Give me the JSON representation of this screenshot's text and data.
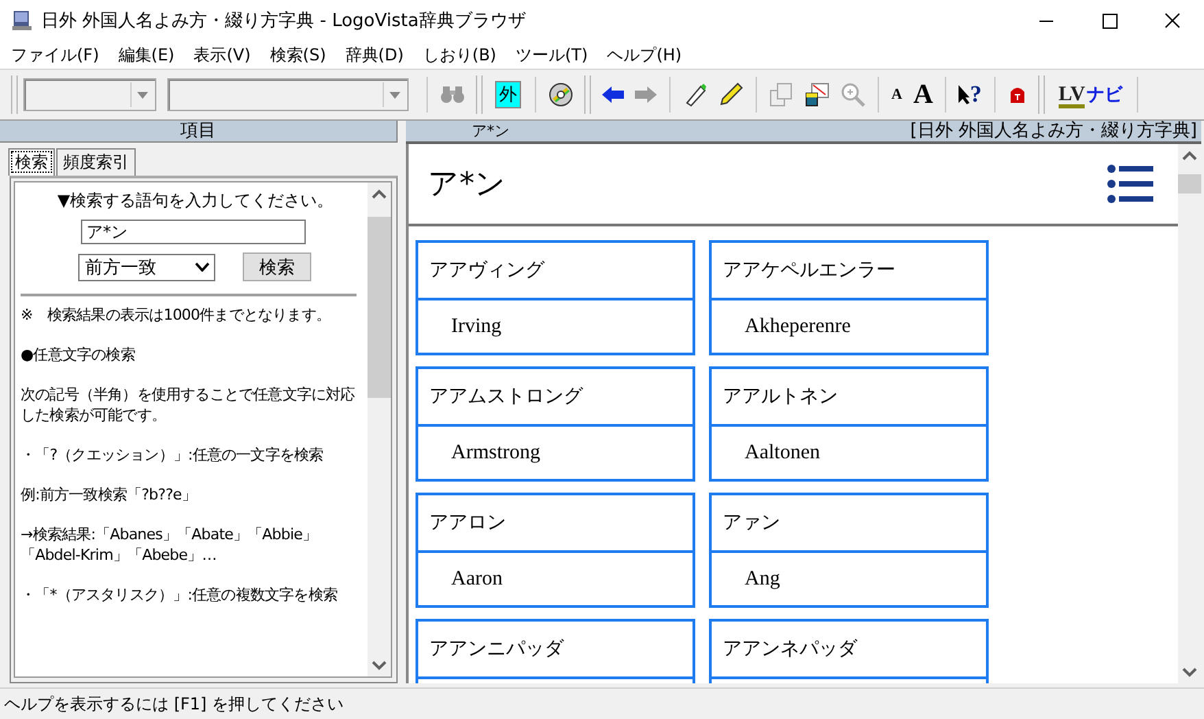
{
  "window": {
    "title": "日外 外国人名よみ方・綴り方字典 - LogoVista辞典ブラウザ"
  },
  "menu": [
    "ファイル(F)",
    "編集(E)",
    "表示(V)",
    "検索(S)",
    "辞典(D)",
    "しおり(B)",
    "ツール(T)",
    "ヘルプ(H)"
  ],
  "toolbar": {
    "dictionary_button": "外",
    "font_small": "A",
    "font_large": "A",
    "help_button": "?",
    "navi_logo": "LV",
    "navi_label": "ナビ"
  },
  "left_pane": {
    "title": "項目",
    "tabs": [
      {
        "label": "検索",
        "selected": true
      },
      {
        "label": "頻度索引",
        "selected": false
      }
    ],
    "prompt": "▼検索する語句を入力してください。",
    "search": {
      "value": "ア*ン"
    },
    "match_mode": "前方一致",
    "search_button": "検索",
    "help_paragraphs": [
      "※　検索結果の表示は1000件までとなります。",
      "●任意文字の検索",
      "次の記号（半角）を使用することで任意文字に対応した検索が可能です。",
      "・「?（クエッション）」:任意の一文字を検索",
      "例:前方一致検索「?b??e」",
      "→検索結果:「Abanes」「Abate」「Abbie」「Abdel-Krim」「Abebe」…",
      "・「*（アスタリスク）」:任意の複数文字を検索"
    ]
  },
  "right_pane": {
    "header_term": "ア*ン",
    "header_dictionary": "[日外 外国人名よみ方・綴り方字典]",
    "heading": "ア*ン",
    "entries": [
      {
        "reading": "アアヴィング",
        "name": "Irving"
      },
      {
        "reading": "アアケペルエンラー",
        "name": "Akheperenre"
      },
      {
        "reading": "アアムストロング",
        "name": "Armstrong"
      },
      {
        "reading": "アアルトネン",
        "name": "Aaltonen"
      },
      {
        "reading": "アアロン",
        "name": "Aaron"
      },
      {
        "reading": "アァン",
        "name": "Ang"
      },
      {
        "reading": "アアンニパッダ"
      },
      {
        "reading": "アアンネパッダ"
      }
    ]
  },
  "status_bar": "ヘルプを表示するには [F1] を押してください"
}
